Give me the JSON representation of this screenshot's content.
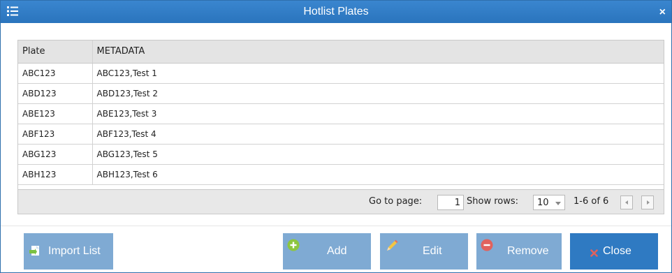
{
  "dialog": {
    "title": "Hotlist Plates",
    "close_glyph": "×"
  },
  "table": {
    "columns": [
      "Plate",
      "METADATA"
    ],
    "rows": [
      [
        "ABC123",
        "ABC123,Test 1"
      ],
      [
        "ABD123",
        "ABD123,Test 2"
      ],
      [
        "ABE123",
        "ABE123,Test 3"
      ],
      [
        "ABF123",
        "ABF123,Test 4"
      ],
      [
        "ABG123",
        "ABG123,Test 5"
      ],
      [
        "ABH123",
        "ABH123,Test 6"
      ]
    ]
  },
  "pager": {
    "go_to_page_label": "Go to page:",
    "page_value": "1",
    "show_rows_label": "Show rows:",
    "rows_value": "10",
    "range_text": "1-6 of 6"
  },
  "buttons": {
    "import": "Import List",
    "add": "Add",
    "edit": "Edit",
    "remove": "Remove",
    "close": "Close"
  },
  "icons": {
    "menu": "list-menu-icon",
    "import": "import-file-icon",
    "add": "plus-circle-icon",
    "edit": "pencil-icon",
    "remove": "minus-circle-icon",
    "close": "x-icon"
  },
  "colors": {
    "titlebar": "#2a74bd",
    "button_faded": "#7faad3",
    "button_primary": "#2f7ac2",
    "add_icon": "#8dc63f",
    "remove_icon": "#e0625d",
    "close_icon": "#e0625d"
  }
}
